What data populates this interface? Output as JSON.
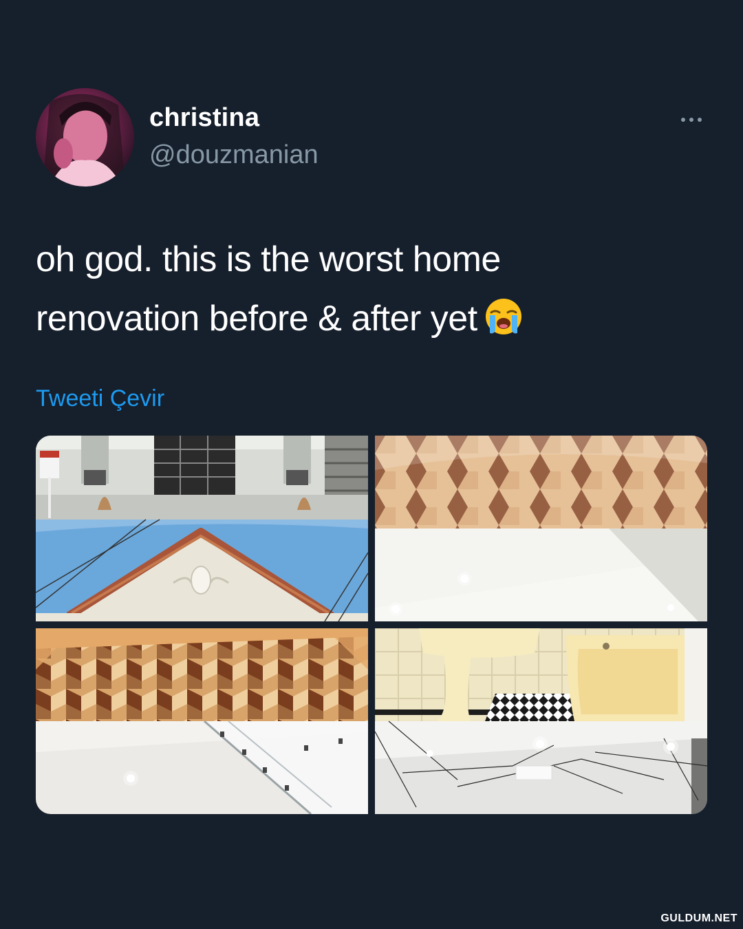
{
  "tweet": {
    "author": {
      "display_name": "christina",
      "handle": "@douzmanian",
      "avatar_icon": "profile-photo"
    },
    "more_icon": "more-horizontal-icon",
    "text_line1": "oh god. this is the worst home",
    "text_line2": "renovation before & after yet",
    "emoji": "loudly-crying-face",
    "translate_label": "Tweeti Çevir",
    "media": [
      {
        "label": "house exterior and gable roof (before)"
      },
      {
        "label": "hexagon parquet floor and ceiling (after)"
      },
      {
        "label": "chevron parquet floor and glass staircase (after)"
      },
      {
        "label": "old bathroom and new bathroom"
      }
    ]
  },
  "watermark": "GULDUM.NET",
  "colors": {
    "background": "#161f2c",
    "text": "#ffffff",
    "secondary": "#8899a6",
    "link": "#1d9bf0"
  }
}
